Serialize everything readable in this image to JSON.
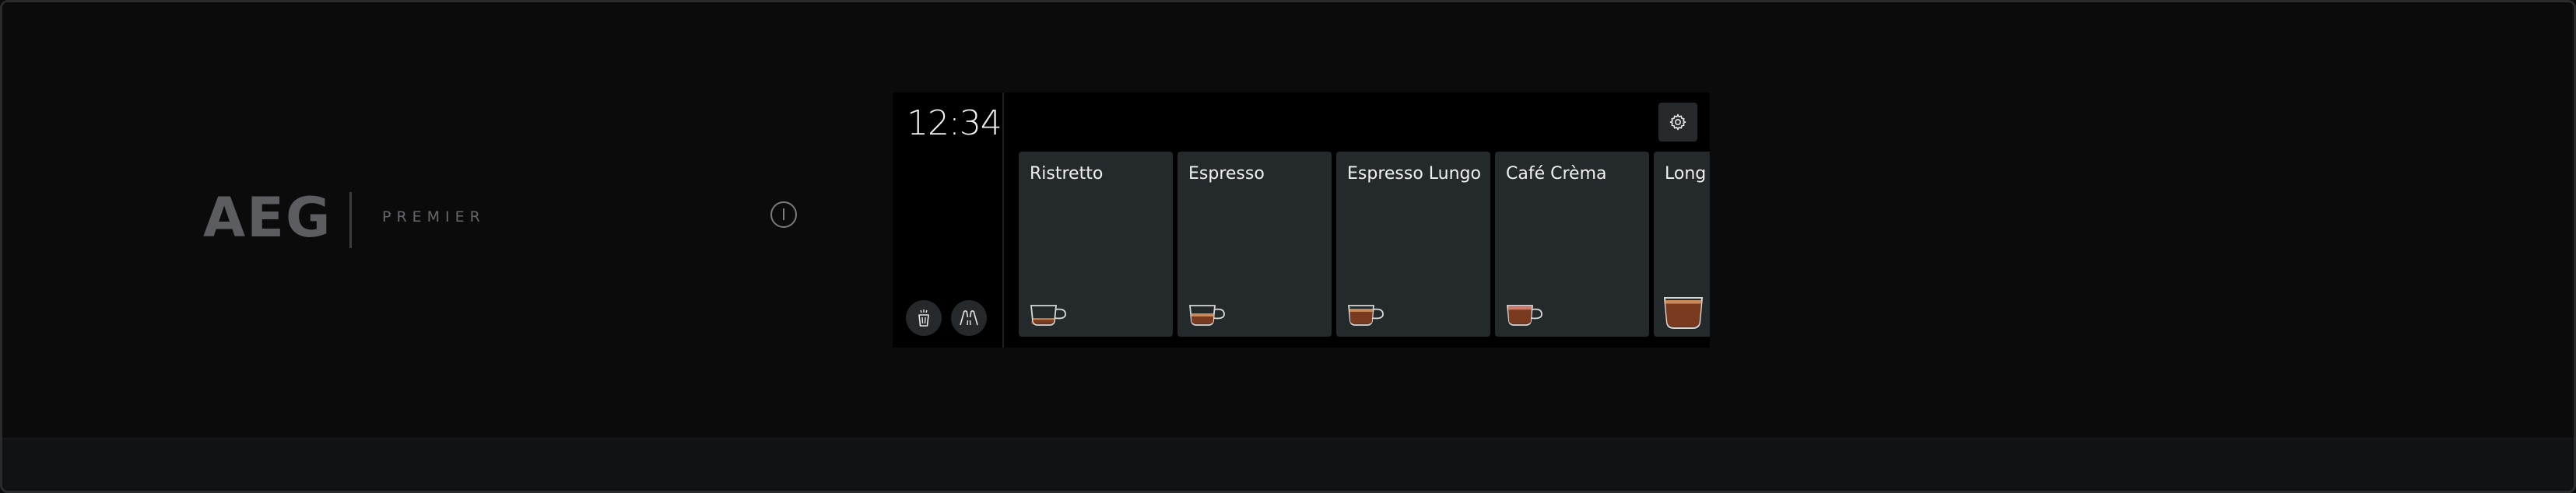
{
  "brand": {
    "logo_text": "AEG",
    "sub_text": "PREMIER"
  },
  "screen": {
    "clock": "12:34",
    "left_buttons": [
      {
        "icon": "cleaning-icon"
      },
      {
        "icon": "milk-system-icon"
      }
    ],
    "settings_icon": "gear-icon",
    "beverages": [
      {
        "label": "Ristretto",
        "icon": "ristretto-cup-icon"
      },
      {
        "label": "Espresso",
        "icon": "espresso-cup-icon"
      },
      {
        "label": "Espresso Lungo",
        "icon": "espresso-lungo-cup-icon"
      },
      {
        "label": "Café Crèma",
        "icon": "cafe-crema-cup-icon"
      },
      {
        "label": "Long Coffee",
        "icon": "long-coffee-cup-icon"
      }
    ]
  },
  "colors": {
    "panel": "#0b0b0c",
    "card": "#242a2b",
    "button": "#26292b",
    "coffee": "#7a3a20",
    "crema": "#c98a5a",
    "cup_outline": "#d8d8d8"
  }
}
